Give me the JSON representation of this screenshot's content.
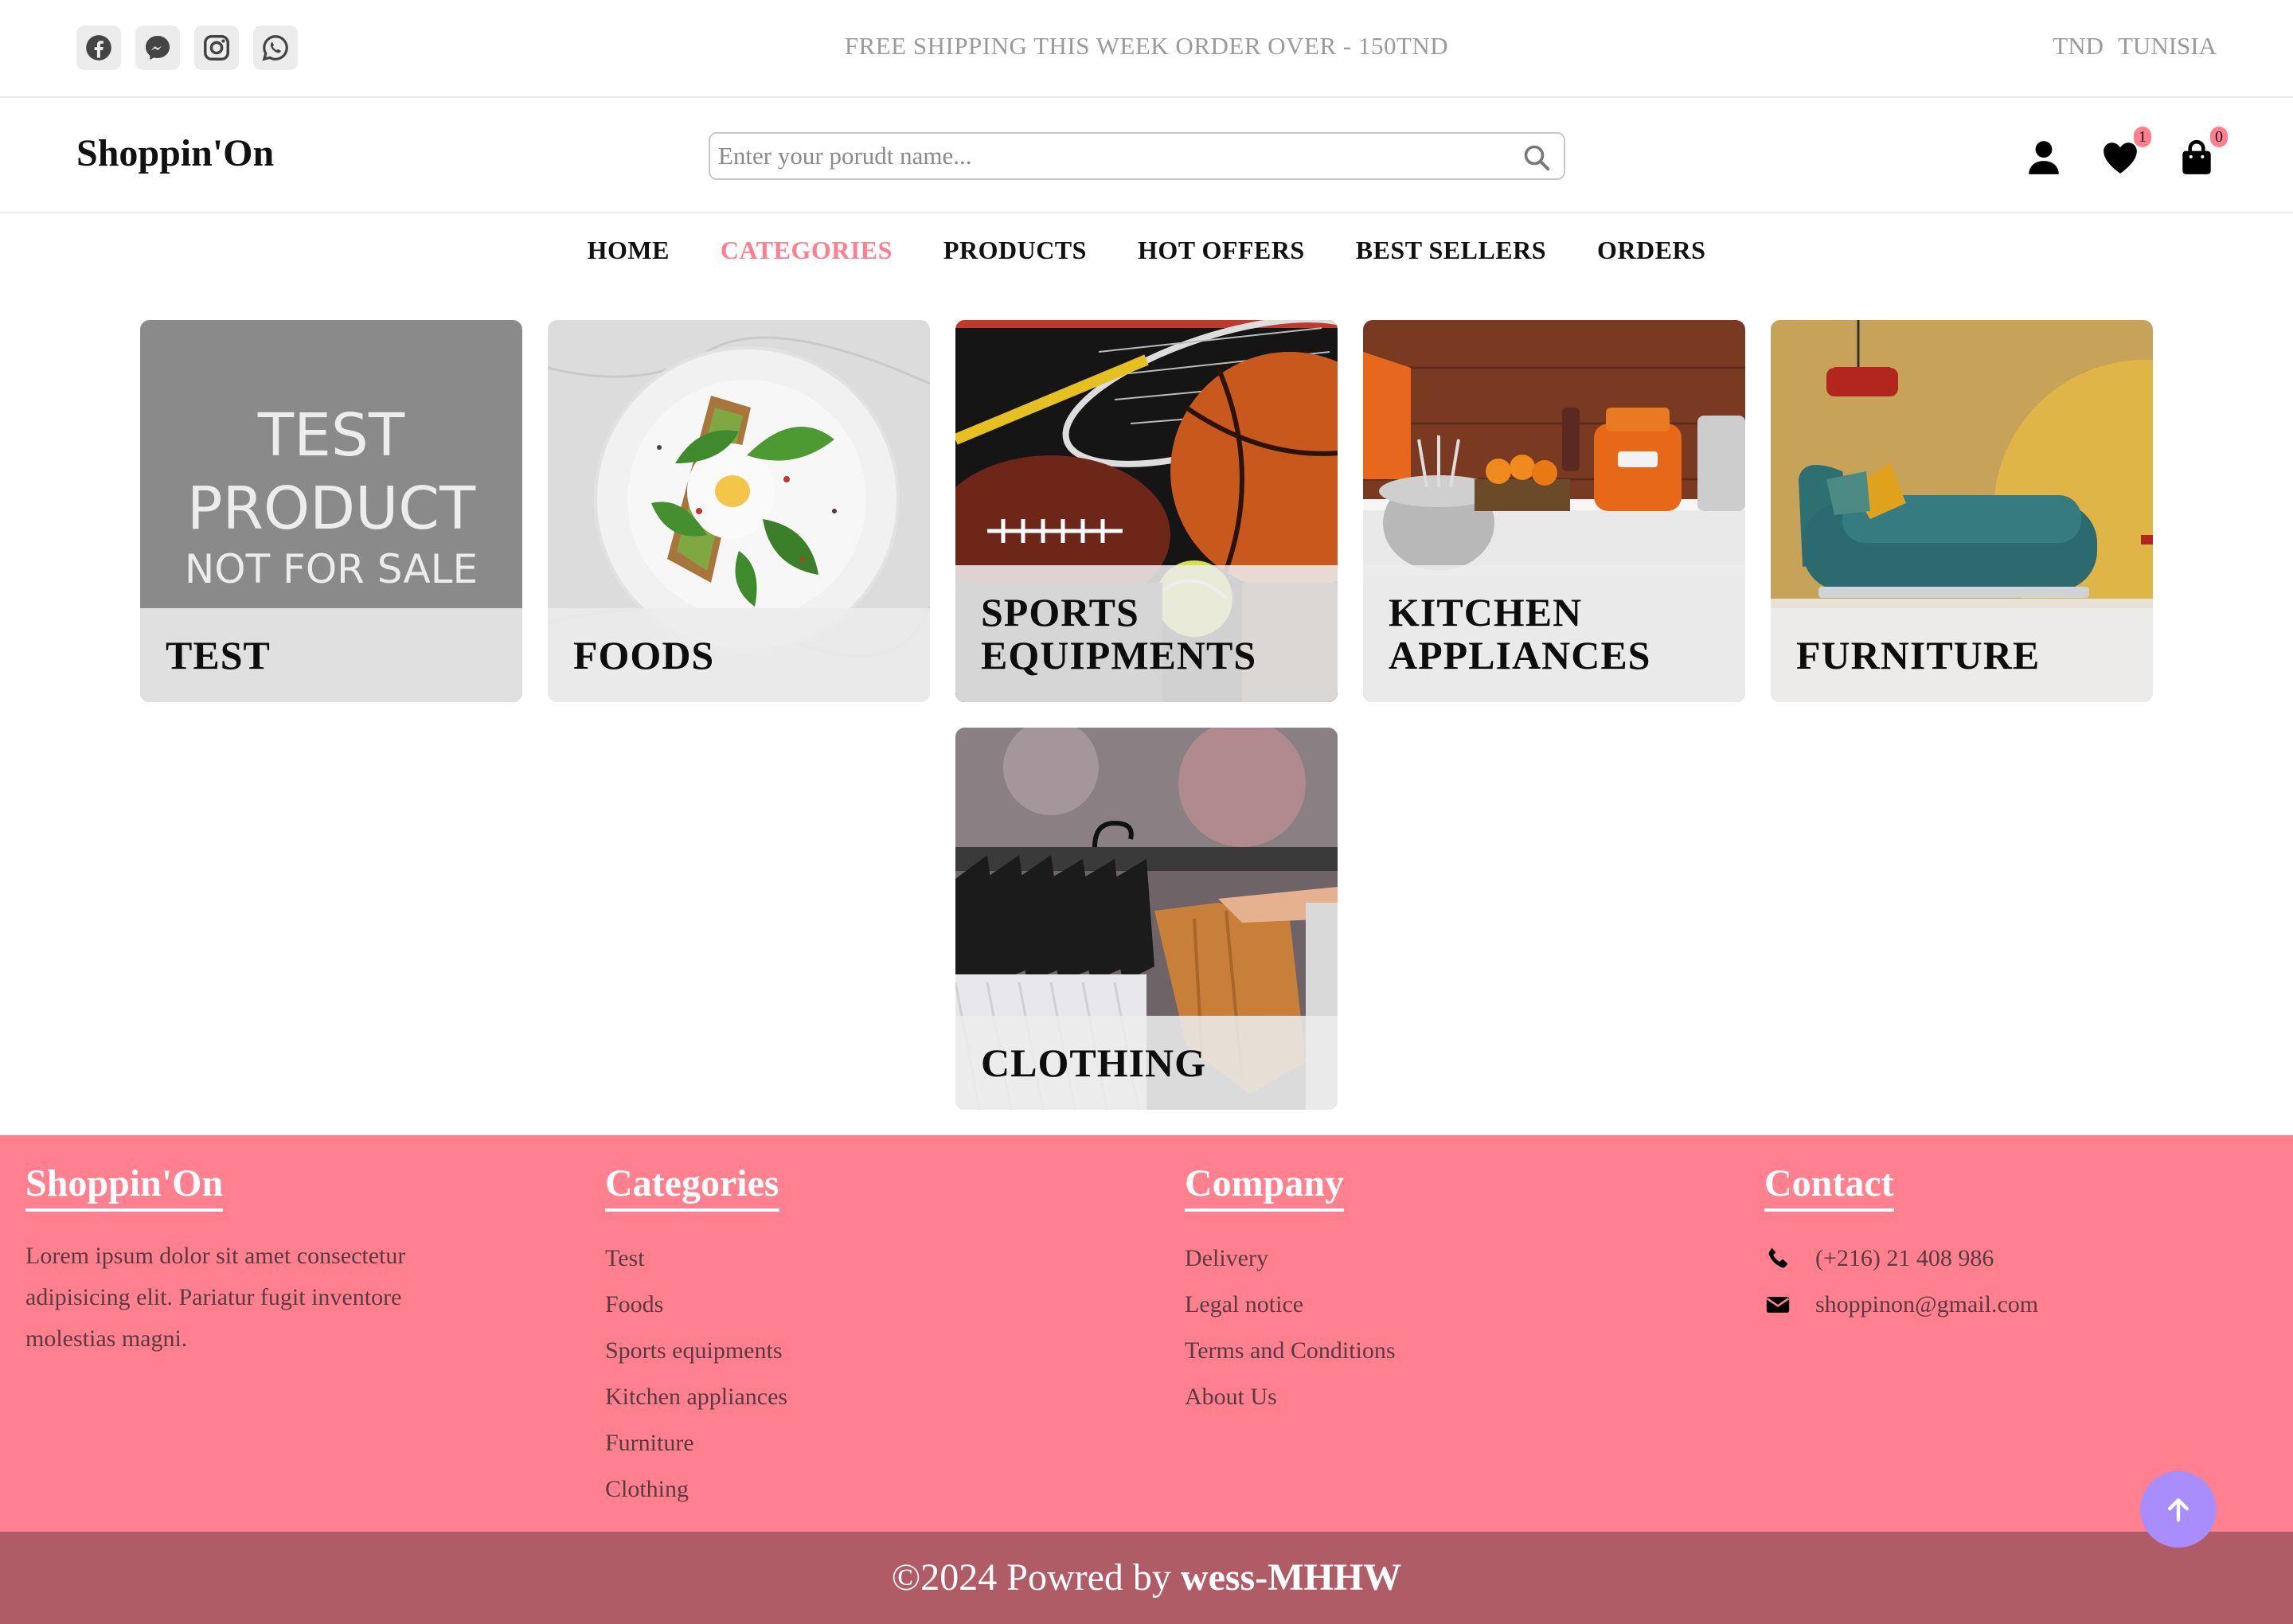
{
  "topbar": {
    "socials": [
      "facebook-icon",
      "messenger-icon",
      "instagram-icon",
      "whatsapp-icon"
    ],
    "shipping_text": "FREE SHIPPING THIS WEEK ORDER OVER - 150TND",
    "currency": "TND",
    "country": "TUNISIA"
  },
  "header": {
    "logo": "Shoppin'On",
    "search_placeholder": "Enter your porudt name...",
    "search_value": "",
    "wishlist_count": "1",
    "cart_count": "0"
  },
  "nav": {
    "items": [
      "HOME",
      "CATEGORIES",
      "PRODUCTS",
      "HOT OFFERS",
      "BEST SELLERS",
      "ORDERS"
    ],
    "active": "CATEGORIES"
  },
  "categories": [
    {
      "label": "TEST",
      "image": {
        "line1": "TEST",
        "line2": "PRODUCT",
        "line3": "NOT FOR SALE"
      }
    },
    {
      "label": "FOODS"
    },
    {
      "label_line1": "SPORTS",
      "label_line2": "EQUIPMENTS"
    },
    {
      "label_line1": "KITCHEN",
      "label_line2": "APPLIANCES"
    },
    {
      "label": "FURNITURE"
    },
    {
      "label": "CLOTHING"
    }
  ],
  "footer": {
    "brand": {
      "title": "Shoppin'On",
      "text": "Lorem ipsum dolor sit amet consectetur adipisicing elit. Pariatur fugit inventore molestias magni."
    },
    "categories": {
      "title": "Categories",
      "links": [
        "Test",
        "Foods",
        "Sports equipments",
        "Kitchen appliances",
        "Furniture",
        "Clothing"
      ]
    },
    "company": {
      "title": "Company",
      "links": [
        "Delivery",
        "Legal notice",
        "Terms and Conditions",
        "About Us"
      ]
    },
    "contact": {
      "title": "Contact",
      "phone": "(+216) 21 408 986",
      "email": "shoppinon@gmail.com"
    }
  },
  "copyright": {
    "prefix": "©2024 Powred by ",
    "author": "wess-MHHW"
  },
  "colors": {
    "accent": "#ff7f8e",
    "footer_bg": "#ff808f",
    "copyright_bg": "#b05c66",
    "scroll_top_button": "#a98dfc"
  }
}
